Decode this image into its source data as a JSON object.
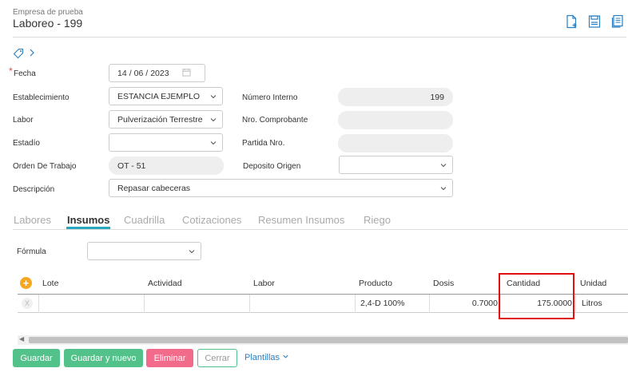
{
  "header": {
    "company": "Empresa de prueba",
    "title": "Laboreo - 199"
  },
  "form": {
    "fecha": {
      "label": "Fecha",
      "required_mark": "*",
      "day": "14",
      "month": "06",
      "year": "2023"
    },
    "establecimiento": {
      "label": "Establecimiento",
      "value": "ESTANCIA EJEMPLO"
    },
    "numero_interno": {
      "label": "Número Interno",
      "value": "199"
    },
    "labor": {
      "label": "Labor",
      "value": "Pulverización Terrestre"
    },
    "nro_comprobante": {
      "label": "Nro. Comprobante",
      "value": ""
    },
    "estadio": {
      "label": "Estadío",
      "value": ""
    },
    "partida_nro": {
      "label": "Partida Nro.",
      "value": ""
    },
    "orden_trabajo": {
      "label": "Orden De Trabajo",
      "value": "OT - 51"
    },
    "deposito_origen": {
      "label": "Deposito Origen",
      "value": ""
    },
    "descripcion": {
      "label": "Descripción",
      "value": "Repasar cabeceras"
    }
  },
  "tabs": [
    {
      "label": "Labores",
      "active": false
    },
    {
      "label": "Insumos",
      "active": true
    },
    {
      "label": "Cuadrilla",
      "active": false
    },
    {
      "label": "Cotizaciones",
      "active": false
    },
    {
      "label": "Resumen Insumos",
      "active": false
    },
    {
      "label": "Riego",
      "active": false
    }
  ],
  "insumos": {
    "formula_label": "Fórmula",
    "formula_value": "",
    "add_symbol": "+",
    "remove_symbol": "X",
    "columns": [
      "Lote",
      "Actividad",
      "Labor",
      "Producto",
      "Dosis",
      "Cantidad",
      "Unidad"
    ],
    "rows": [
      {
        "lote": "",
        "actividad": "",
        "labor": "",
        "producto": "2,4-D 100%",
        "dosis": "0.7000",
        "cantidad": "175.0000",
        "unidad": "Litros"
      }
    ]
  },
  "footer": {
    "guardar": "Guardar",
    "guardar_nuevo": "Guardar y nuevo",
    "eliminar": "Eliminar",
    "cerrar": "Cerrar",
    "plantillas": "Plantillas"
  },
  "colors": {
    "accent_tab": "#2aa7c0",
    "button_green": "#52c28a",
    "button_pink": "#f26b8a",
    "highlight_box": "#e01010",
    "icon_blue": "#2a7fc2",
    "add_orange": "#f5a623"
  },
  "icons": {
    "new_doc": "new-document-icon",
    "save": "save-icon",
    "copy": "copy-icon",
    "tag": "tag-icon",
    "calendar": "calendar-icon"
  }
}
